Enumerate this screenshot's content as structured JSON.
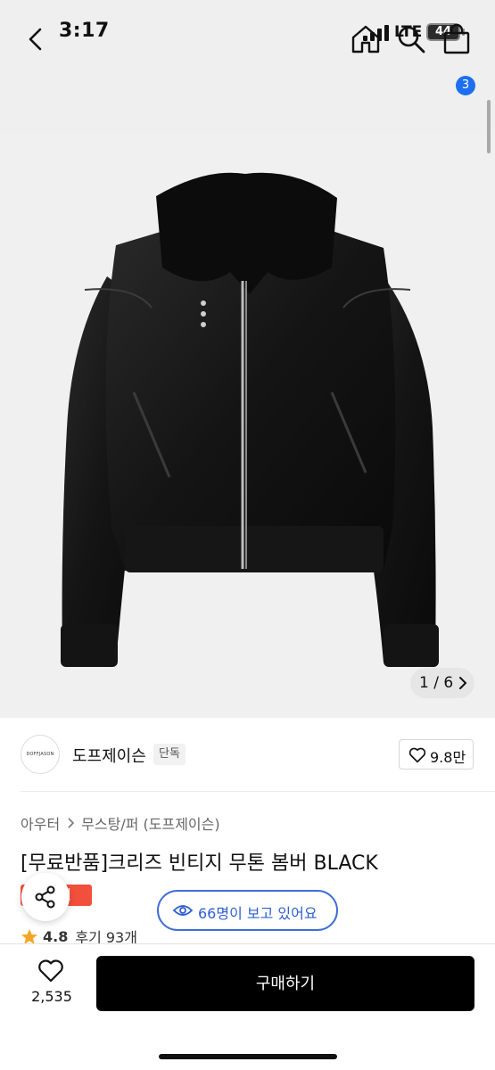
{
  "status_bar": {
    "time": "3:17",
    "network": "LTE",
    "battery": "44"
  },
  "nav": {
    "cart_count": "3",
    "icons": [
      "back-icon",
      "home-icon",
      "search-icon",
      "shopping-bag-icon"
    ]
  },
  "gallery": {
    "counter": "1 / 6"
  },
  "brand": {
    "logo_text": "DOFFJASON",
    "name": "도프제이슨",
    "tag": "단독",
    "likes": "9.8만"
  },
  "breadcrumb": {
    "category": "아우터",
    "subcategory": "무스탕/퍼 (도프제이슨)"
  },
  "product": {
    "title": "[무료반품]크리즈 빈티지 무톤 봄버 BLACK",
    "badge": "일",
    "viewers": "66명이 보고 있어요",
    "rating": "4.8",
    "reviews": "후기 93개"
  },
  "bottom": {
    "wish_count": "2,535",
    "buy_label": "구매하기"
  },
  "colors": {
    "accent_blue": "#2d5fcf",
    "badge_blue": "#1e6ff0",
    "sale_red": "#f1503c",
    "star": "#f5a623"
  }
}
